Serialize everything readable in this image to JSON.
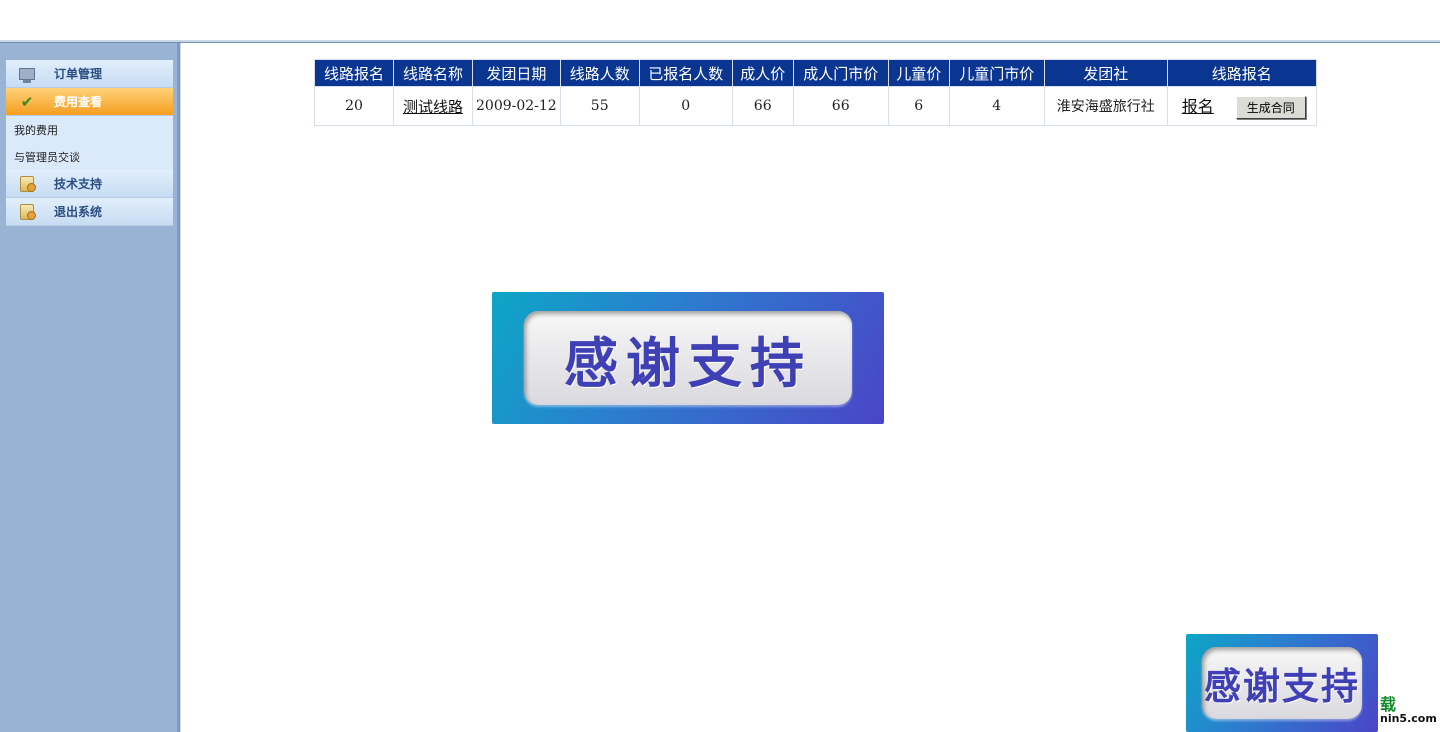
{
  "sidebar": {
    "menu": [
      {
        "label": "订单管理",
        "icon": "computer-icon"
      },
      {
        "label": "费用查看",
        "icon": "check-icon",
        "active": true
      },
      {
        "label": "技术支持",
        "icon": "document-icon"
      },
      {
        "label": "退出系统",
        "icon": "document-icon"
      }
    ],
    "submenu": [
      "我的费用",
      "与管理员交谈"
    ]
  },
  "table": {
    "headers": [
      "线路报名",
      "线路名称",
      "发团日期",
      "线路人数",
      "已报名人数",
      "成人价",
      "成人门市价",
      "儿童价",
      "儿童门市价",
      "发团社",
      "线路报名"
    ],
    "row": {
      "id": "20",
      "name": "测试线路",
      "date": "2009-02-12",
      "capacity": "55",
      "enrolled": "0",
      "adult_price": "66",
      "adult_retail": "66",
      "child_price": "6",
      "child_retail": "4",
      "agency": "淮安海盛旅行社",
      "signup_link": "报名",
      "contract_button": "生成合同"
    }
  },
  "banners": {
    "large_text": "感谢支持",
    "small_text": "感谢支持"
  },
  "watermark": {
    "glyph": "载",
    "text": "nin5.com"
  }
}
